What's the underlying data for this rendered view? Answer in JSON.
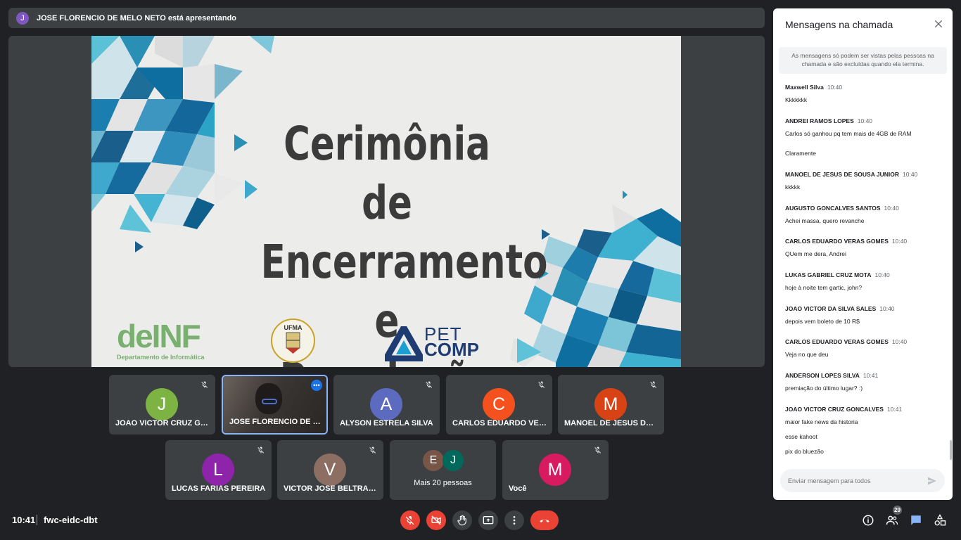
{
  "presenter_bar": {
    "avatar_letter": "J",
    "text": "JOSE FLORENCIO DE MELO NETO está apresentando"
  },
  "slide": {
    "title_lines": [
      "Cerimônia de",
      "Encerramento e",
      "Premiação"
    ],
    "logo_deinf": "deINF",
    "logo_deinf_sub": "Departamento de Informática",
    "logo_ufma": "UFMA",
    "logo_pet": "PET",
    "logo_comp": "COMP"
  },
  "participants": [
    {
      "letter": "J",
      "name": "JOAO VICTOR CRUZ GONCALVES",
      "color": "#7cb342"
    },
    {
      "letter": "",
      "name": "JOSE FLORENCIO DE MELO NETO",
      "color": ""
    },
    {
      "letter": "A",
      "name": "ALYSON ESTRELA SILVA",
      "color": "#5c6bc0"
    },
    {
      "letter": "C",
      "name": "CARLOS EDUARDO VERAS GOMES",
      "color": "#f4511e"
    },
    {
      "letter": "M",
      "name": "MANOEL DE JESUS DE SOUSA JUNIOR",
      "color": "#d84315"
    },
    {
      "letter": "L",
      "name": "LUCAS FARIAS PEREIRA",
      "color": "#8e24aa"
    },
    {
      "letter": "V",
      "name": "VICTOR JOSE BELTRAO ALMEIDA",
      "color": "#8d6e63"
    },
    {
      "letter": "M",
      "name": "Você",
      "color": "#d81b60"
    }
  ],
  "more_tile": {
    "letters": [
      "E",
      "J"
    ],
    "colors": [
      "#795548",
      "#00695c"
    ],
    "label": "Mais 20 pessoas"
  },
  "bottom_bar": {
    "time": "10:41",
    "meeting_code": "fwc-eidc-dbt",
    "participant_count": "29"
  },
  "chat": {
    "title": "Mensagens na chamada",
    "notice": "As mensagens só podem ser vistas pelas pessoas na chamada e são excluídas quando ela termina.",
    "input_placeholder": "Enviar mensagem para todos",
    "messages": [
      {
        "sender": "Maxwell Silva",
        "time": "10:40",
        "lines": [
          "Kkkkkkk"
        ]
      },
      {
        "sender": "ANDREI RAMOS LOPES",
        "time": "10:40",
        "lines": [
          "Carlos só ganhou pq tem mais de 4GB de RAM",
          "Claramente"
        ]
      },
      {
        "sender": "MANOEL DE JESUS DE SOUSA JUNIOR",
        "time": "10:40",
        "lines": [
          "kkkkk"
        ]
      },
      {
        "sender": "AUGUSTO GONCALVES SANTOS",
        "time": "10:40",
        "lines": [
          "Achei massa, quero revanche"
        ]
      },
      {
        "sender": "CARLOS EDUARDO VERAS GOMES",
        "time": "10:40",
        "lines": [
          "QUem me dera, Andrei"
        ]
      },
      {
        "sender": "LUKAS GABRIEL CRUZ MOTA",
        "time": "10:40",
        "lines": [
          "hoje à noite tem gartic, john?"
        ]
      },
      {
        "sender": "JOAO VICTOR DA SILVA SALES",
        "time": "10:40",
        "lines": [
          "depois vem boleto de 10 R$"
        ]
      },
      {
        "sender": "CARLOS EDUARDO VERAS GOMES",
        "time": "10:40",
        "lines": [
          "Veja no que deu"
        ]
      },
      {
        "sender": "ANDERSON LOPES SILVA",
        "time": "10:41",
        "lines": [
          "premiação do último lugar? :)"
        ]
      },
      {
        "sender": "JOAO VICTOR CRUZ GONCALVES",
        "time": "10:41",
        "lines": [
          "maior fake news da historia",
          "esse kahoot",
          "pix do bluezão"
        ]
      }
    ]
  },
  "icons": {
    "presenter": "presenter-avatar",
    "muted": "mic-off-icon",
    "controls": [
      "mic-off-icon",
      "camera-off-icon",
      "raise-hand-icon",
      "present-icon",
      "more-vert-icon",
      "hang-up-icon"
    ],
    "side": [
      "info-icon",
      "people-icon",
      "chat-icon",
      "activities-icon"
    ]
  },
  "colors": {
    "accent": "#8ab4f8",
    "danger": "#ea4335",
    "surface": "#3c4043",
    "background": "#202124"
  }
}
